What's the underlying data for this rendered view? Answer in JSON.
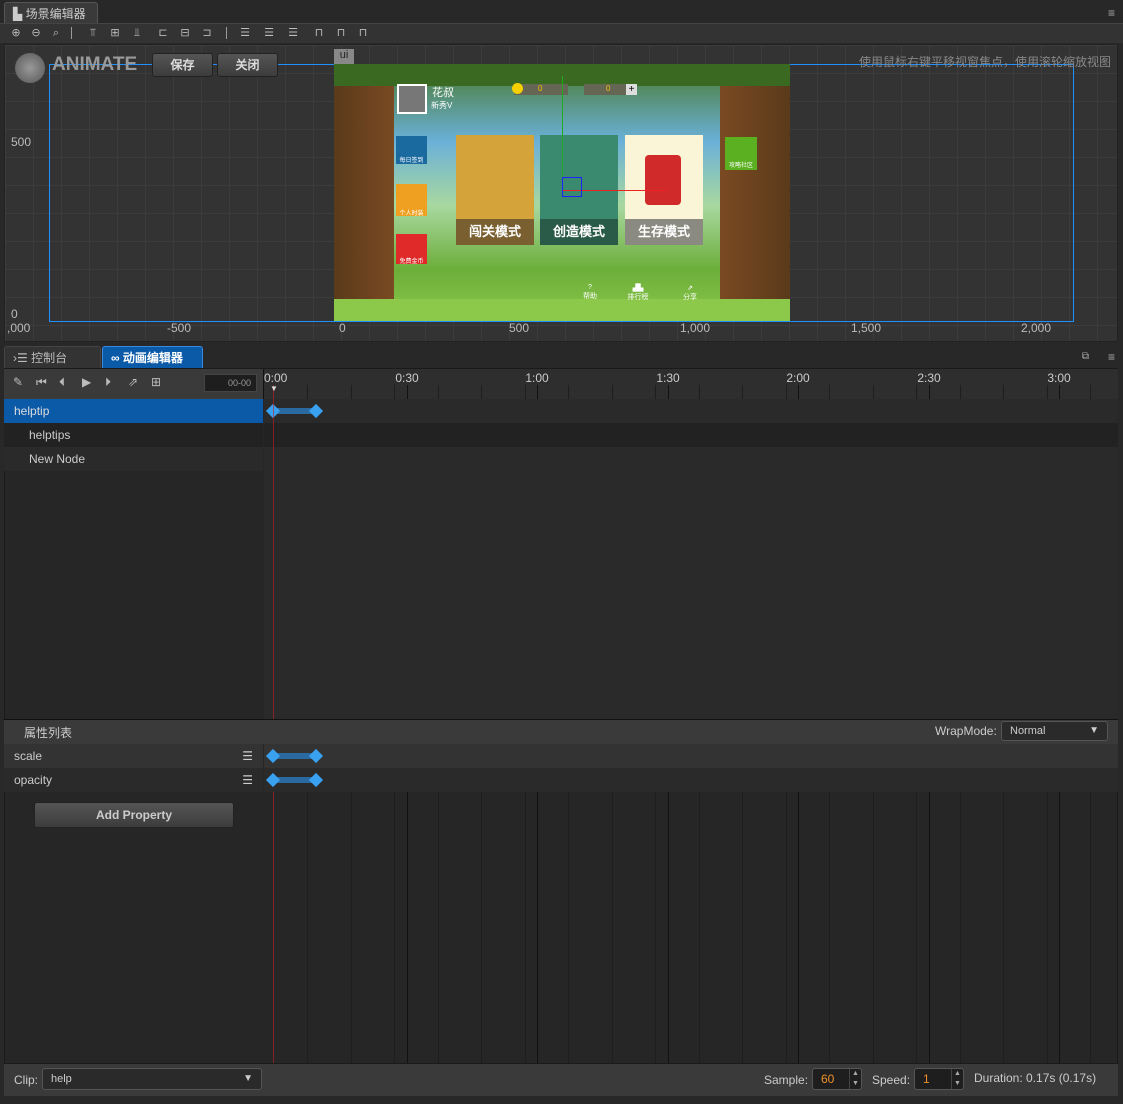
{
  "scene_tab": {
    "label": "场景编辑器",
    "icon": "scene-icon"
  },
  "toolbar": {
    "icons": [
      "zoom-in-icon",
      "zoom-out-icon",
      "zoom-reset-icon",
      "align-top-icon",
      "align-vcenter-icon",
      "align-bottom-icon",
      "align-left-icon",
      "align-hcenter-icon",
      "align-right-icon",
      "distribute-top-icon",
      "distribute-vcenter-icon",
      "distribute-bottom-icon",
      "distribute-left-icon",
      "distribute-hcenter-icon",
      "distribute-right-icon"
    ]
  },
  "scene": {
    "animate_label": "ANIMATE",
    "save": "保存",
    "close": "关闭",
    "canvas_tag": "ui",
    "hint": "使用鼠标右键平移视窗焦点，使用滚轮缩放视图",
    "y_ticks": [
      "500",
      "0"
    ],
    "x_ticks": [
      ",000",
      "-500",
      "0",
      "500",
      "1,000",
      "1,500",
      "2,000"
    ],
    "game": {
      "player_name": "花叔",
      "player_level": "新秀V",
      "coins": "0",
      "hints": "0",
      "side_buttons": [
        "每日签到",
        "个人时装",
        "免费金币"
      ],
      "community": "攻略社区",
      "modes": [
        "闯关模式",
        "创造模式",
        "生存模式"
      ],
      "bottom_buttons": [
        "帮助",
        "排行榜",
        "分享"
      ]
    }
  },
  "panel_tabs": [
    {
      "label": "控制台",
      "icon": "console-icon"
    },
    {
      "label": "动画编辑器",
      "icon": "animation-icon"
    }
  ],
  "anim": {
    "controls": [
      "edit-icon",
      "jump-first-icon",
      "prev-frame-icon",
      "play-icon",
      "next-frame-icon",
      "export-icon",
      "add-event-icon"
    ],
    "frame_value": "00-00",
    "ruler": [
      "0:00",
      "0:30",
      "1:00",
      "1:30",
      "2:00",
      "2:30",
      "3:00"
    ],
    "nodes": [
      {
        "label": "helptip",
        "selected": true
      },
      {
        "label": "helptips"
      },
      {
        "label": "New Node"
      }
    ],
    "properties_title": "属性列表",
    "wrap_mode_label": "WrapMode:",
    "wrap_mode": "Normal",
    "properties": [
      "scale",
      "opacity"
    ],
    "add_property": "Add Property",
    "clip_label": "Clip:",
    "clip": "help",
    "sample_label": "Sample:",
    "sample": "60",
    "speed_label": "Speed:",
    "speed": "1",
    "duration": "Duration: 0.17s (0.17s)"
  },
  "colors": {
    "accent": "#0a5aa8",
    "keyframe": "#3aa0f0",
    "value": "#f0902a"
  }
}
